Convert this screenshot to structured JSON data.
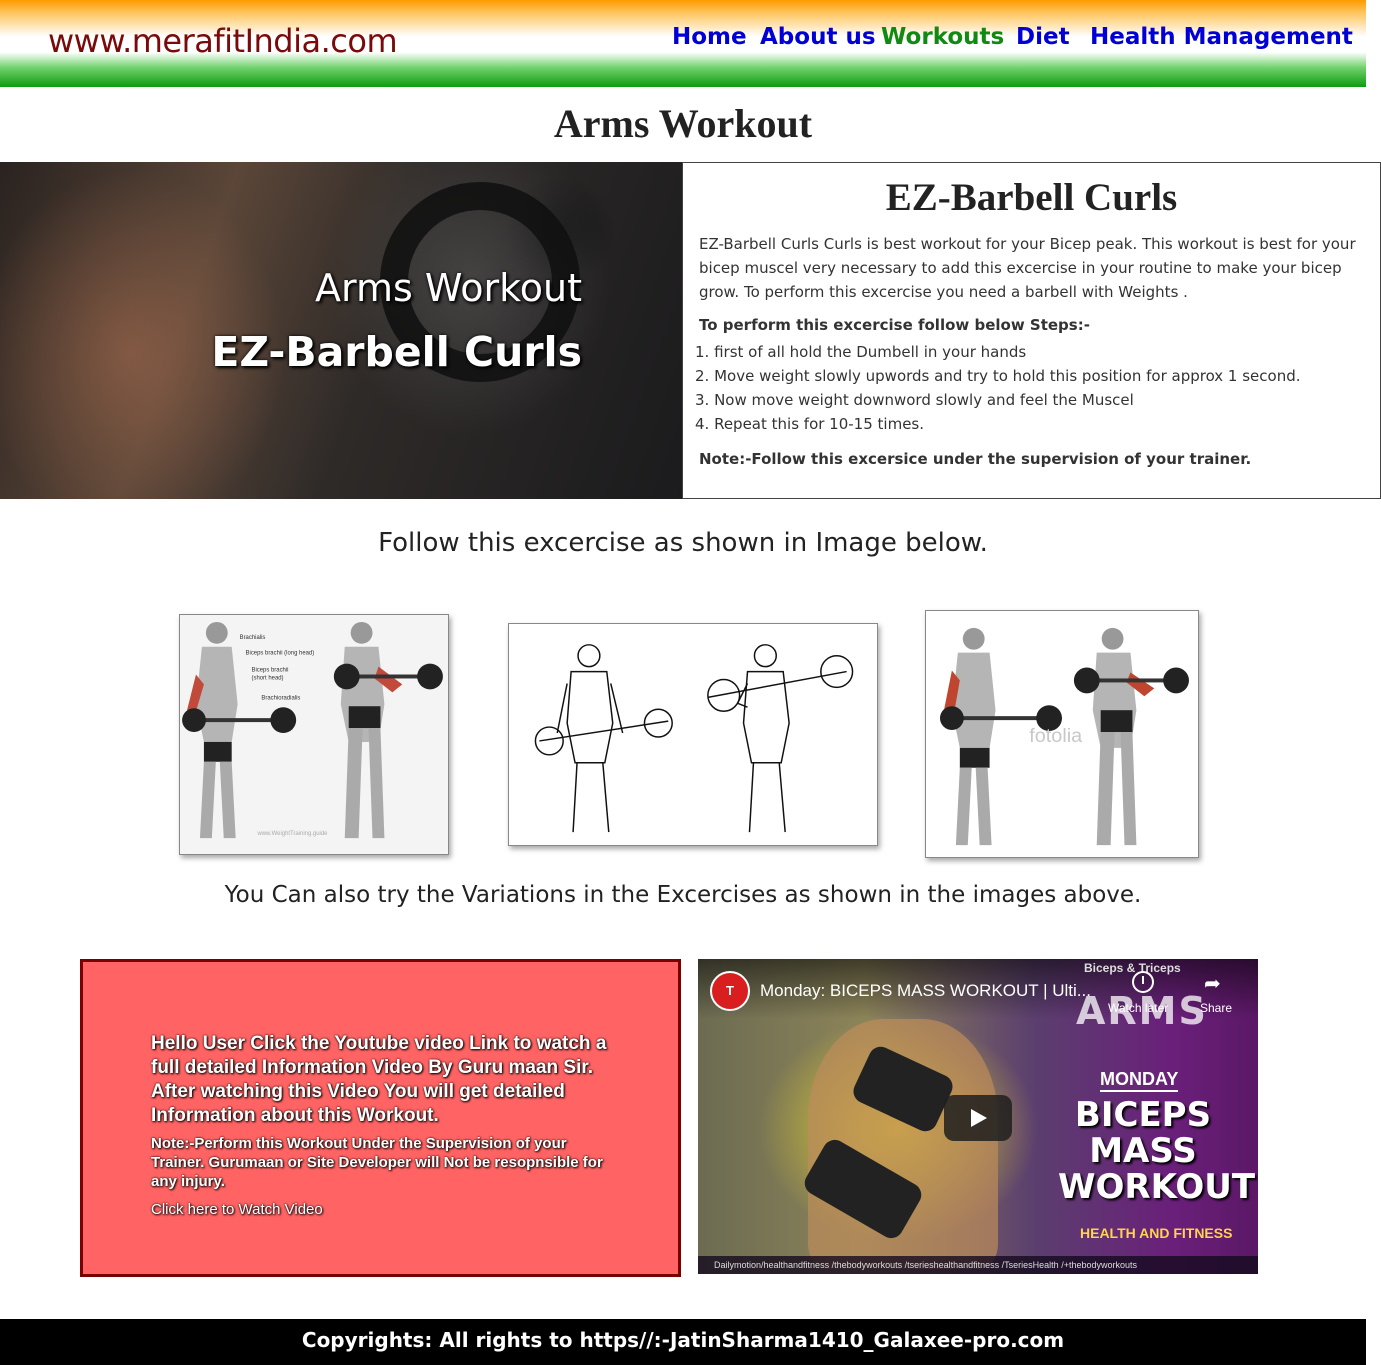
{
  "header": {
    "site_name": "www.merafitIndia.com",
    "nav": [
      {
        "label": "Home"
      },
      {
        "label": "About us"
      },
      {
        "label": "Workouts",
        "active": true
      },
      {
        "label": "Diet"
      },
      {
        "label": "Health Management"
      }
    ],
    "colors": {
      "saffron": "#ff9a00",
      "green": "#109a10",
      "nav_link": "#0000d6",
      "nav_active": "#118a11",
      "brand": "#7a0a0a"
    }
  },
  "page_title": "Arms Workout",
  "hero": {
    "line1": "Arms Workout",
    "line2": "EZ-Barbell Curls"
  },
  "info": {
    "heading": "EZ-Barbell Curls",
    "description": "EZ-Barbell Curls Curls is best workout for your Bicep peak. This workout is best for your bicep muscel very necessary to add this excercise in your routine to make your bicep grow. To perform this excercise you need a barbell with Weights .",
    "steps_heading": "To perform this excercise follow below Steps:-",
    "steps": [
      "1. first of all hold the Dumbell in your hands",
      "2. Move weight slowly upwords and try to hold this position for approx 1 second.",
      "3. Now move weight downword slowly and feel the Muscel",
      "4. Repeat this for 10-15 times."
    ],
    "note": "Note:-Follow this excersice under the supervision of your trainer."
  },
  "follow_text": "Follow this excercise as shown in Image below.",
  "images": {
    "img1_labels": [
      "Brachialis",
      "Biceps brachii (long head)",
      "Biceps brachii",
      "(short head)",
      "Brachioradialis"
    ],
    "img1_watermark": "www.WeightTraining.guide",
    "img3_watermark": "fotolia"
  },
  "variations_text": "You Can also try the Variations in the Excercises as shown in the images above.",
  "callout": {
    "message": "Hello User Click the Youtube video Link to watch a full detailed Information Video By Guru maan Sir. After watching this Video You will get detailed Information about this Workout.",
    "warning": "Note:-Perform this Workout Under the Supervision of your Trainer. Gurumaan or Site Developer will Not be resopnsible for any injury.",
    "link_label": "Click here to Watch Video",
    "bg_color": "#ff6363"
  },
  "video": {
    "title": "Monday: BICEPS MASS WORKOUT | Ulti...",
    "watch_later": "Watch later",
    "share": "Share",
    "tag": "Biceps & Triceps",
    "arms_text": "ARMS",
    "monday": "MONDAY",
    "overlay_title": "BICEPS MASS WORKOUT",
    "brand": "HEALTH AND FITNESS",
    "bottom_strip": "Dailymotion/healthandfitness   /thebodyworkouts   /tserieshealthandfitness   /TseriesHealth   /+thebodyworkouts"
  },
  "footer": {
    "text": "Copyrights: All rights to https//:-JatinSharma1410_Galaxee-pro.com"
  }
}
